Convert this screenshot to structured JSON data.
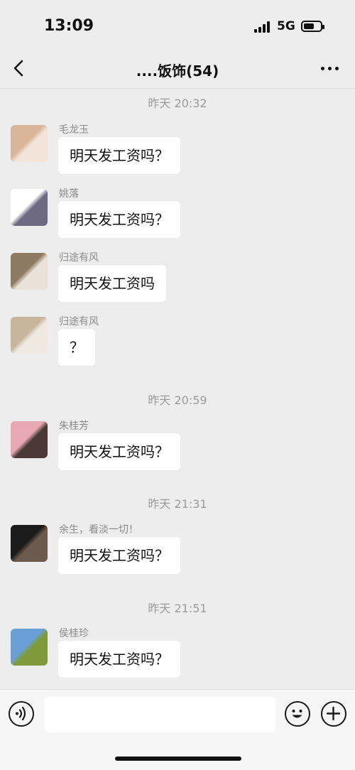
{
  "status_bar": {
    "time": "13:09",
    "network": "5G"
  },
  "nav": {
    "title": "....饭饰(54)"
  },
  "messages": [
    {
      "type": "timestamp",
      "text": "昨天 20:32"
    },
    {
      "type": "message",
      "sender": "毛龙玉",
      "text": "明天发工资吗？",
      "avatar_colors": [
        "#d9b59a",
        "#f3e4d9"
      ]
    },
    {
      "type": "message",
      "sender": "姚落",
      "text": "明天发工资吗？",
      "avatar_colors": [
        "#ffffff",
        "#6e6a82"
      ]
    },
    {
      "type": "message",
      "sender": "归途有风",
      "text": "明天发工资吗",
      "avatar_colors": [
        "#8c7a62",
        "#e8e2d8"
      ]
    },
    {
      "type": "message",
      "sender": "归途有风",
      "text": "？",
      "avatar_colors": [
        "#c7b59c",
        "#efe9e1"
      ]
    },
    {
      "type": "timestamp",
      "text": "昨天 20:59"
    },
    {
      "type": "message",
      "sender": "朱桂芳",
      "text": "明天发工资吗？",
      "avatar_colors": [
        "#e7a8b3",
        "#4a3936"
      ]
    },
    {
      "type": "timestamp",
      "text": "昨天 21:31"
    },
    {
      "type": "message",
      "sender": "余生，看淡一切！",
      "text": "明天发工资吗？",
      "avatar_colors": [
        "#1b1b1b",
        "#6b5a4e"
      ]
    },
    {
      "type": "timestamp",
      "text": "昨天 21:51"
    },
    {
      "type": "message",
      "sender": "侯桂珍",
      "text": "明天发工资吗？",
      "avatar_colors": [
        "#6aa0d6",
        "#7f9a3a"
      ]
    }
  ],
  "input_bar": {
    "placeholder": ""
  },
  "icons": {
    "back": "chevron-left-icon",
    "more": "more-icon",
    "voice": "voice-icon",
    "emoji": "emoji-icon",
    "plus": "plus-icon"
  }
}
